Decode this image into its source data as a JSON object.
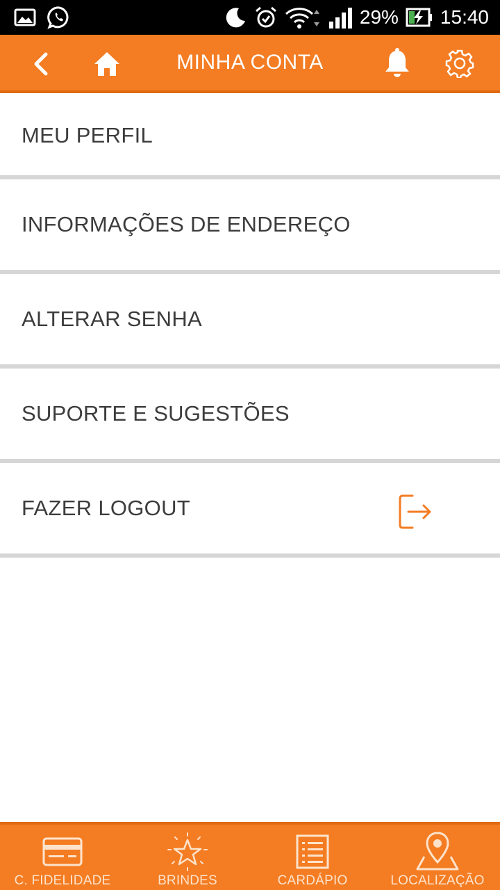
{
  "status_bar": {
    "battery_percent": "29%",
    "time": "15:40",
    "icons": [
      "image-icon",
      "whatsapp-icon",
      "moon-icon",
      "alarm-icon",
      "wifi-icon",
      "signal-icon",
      "battery-charging-icon"
    ]
  },
  "header": {
    "title": "MINHA CONTA",
    "background_color": "#f47c22",
    "icons": [
      "back-arrow-icon",
      "home-icon",
      "bell-icon",
      "gear-icon"
    ]
  },
  "menu": {
    "items": [
      {
        "label": "MEU PERFIL"
      },
      {
        "label": "INFORMAÇÕES DE ENDEREÇO"
      },
      {
        "label": "ALTERAR SENHA"
      },
      {
        "label": "SUPORTE E SUGESTÕES"
      },
      {
        "label": "FAZER LOGOUT",
        "icon": "logout-icon"
      }
    ]
  },
  "bottom_nav": {
    "items": [
      {
        "label": "C. FIDELIDADE",
        "icon": "card-icon"
      },
      {
        "label": "BRINDES",
        "icon": "star-icon"
      },
      {
        "label": "CARDÁPIO",
        "icon": "menu-list-icon"
      },
      {
        "label": "LOCALIZAÇÃO",
        "icon": "map-pin-icon"
      }
    ]
  },
  "colors": {
    "accent": "#f47c22",
    "divider": "#d6d6d6",
    "text": "#3c3c3c"
  }
}
